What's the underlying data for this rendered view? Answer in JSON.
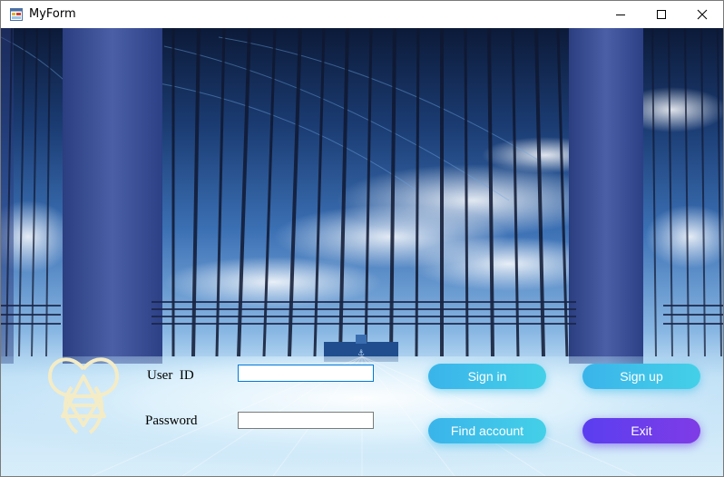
{
  "window": {
    "title": "MyForm"
  },
  "form": {
    "user_id_label": "User  ID",
    "user_id_value": "",
    "password_label": "Password",
    "password_value": ""
  },
  "buttons": {
    "sign_in": "Sign in",
    "sign_up": "Sign up",
    "find_account": "Find account",
    "exit": "Exit"
  },
  "icons": {
    "app": "form-icon",
    "minimize": "minimize-icon",
    "maximize": "maximize-icon",
    "close": "close-icon",
    "logo": "triangle-emblem-logo"
  },
  "colors": {
    "button_cyan": "#3ab4ea",
    "button_purple": "#6a3dec",
    "logo": "#f4ecc6",
    "sky": "#3e74b7"
  }
}
